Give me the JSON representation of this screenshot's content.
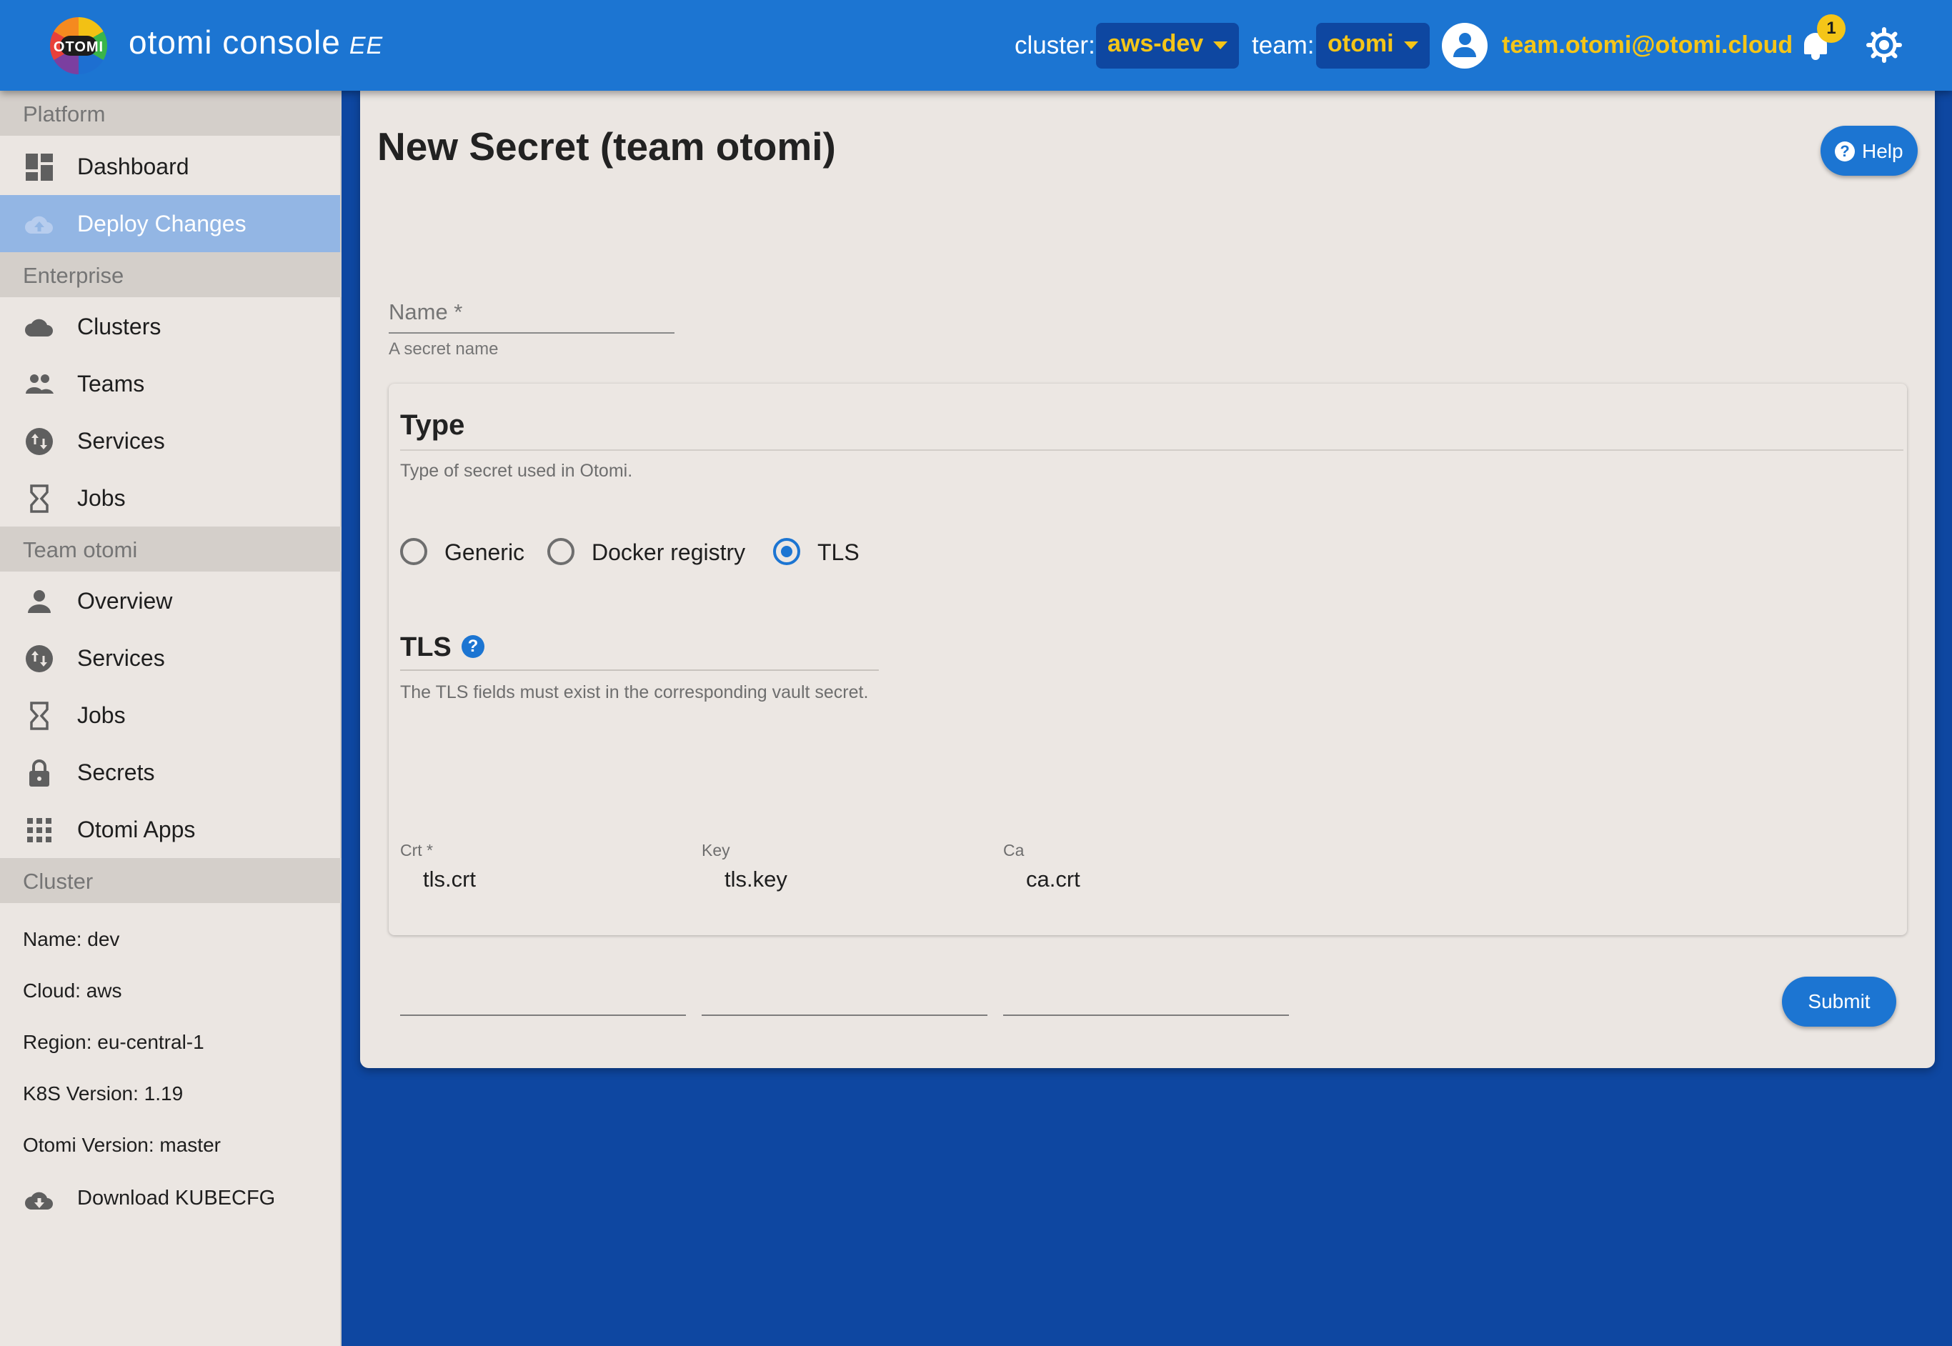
{
  "app": {
    "title": "otomi console",
    "edition": "EE",
    "logo_text": "OTOMI"
  },
  "topbar": {
    "cluster_label": "cluster:",
    "cluster_value": "aws-dev",
    "team_label": "team:",
    "team_value": "otomi",
    "user_email": "team.otomi@otomi.cloud",
    "notification_count": "1"
  },
  "sidebar": {
    "platform": {
      "title": "Platform",
      "items": [
        {
          "label": "Dashboard"
        },
        {
          "label": "Deploy Changes"
        }
      ]
    },
    "enterprise": {
      "title": "Enterprise",
      "items": [
        {
          "label": "Clusters"
        },
        {
          "label": "Teams"
        },
        {
          "label": "Services"
        },
        {
          "label": "Jobs"
        }
      ]
    },
    "team": {
      "title": "Team otomi",
      "items": [
        {
          "label": "Overview"
        },
        {
          "label": "Services"
        },
        {
          "label": "Jobs"
        },
        {
          "label": "Secrets"
        },
        {
          "label": "Otomi Apps"
        }
      ]
    },
    "cluster": {
      "title": "Cluster",
      "info": [
        "Name: dev",
        "Cloud: aws",
        "Region: eu-central-1",
        "K8S Version: 1.19",
        "Otomi Version: master"
      ],
      "download_label": "Download KUBECFG"
    }
  },
  "main": {
    "title": "New Secret (team otomi)",
    "help_label": "Help",
    "name_field": {
      "label": "Name *",
      "helper": "A secret name",
      "value": ""
    },
    "type_section": {
      "title": "Type",
      "description": "Type of secret used in Otomi.",
      "options": [
        "Generic",
        "Docker registry",
        "TLS"
      ],
      "selected": "TLS"
    },
    "tls_section": {
      "title": "TLS",
      "description": "The TLS fields must exist in the corresponding vault secret.",
      "fields": [
        {
          "label": "Crt *",
          "value": "tls.crt"
        },
        {
          "label": "Key",
          "value": "tls.key"
        },
        {
          "label": "Ca",
          "value": "ca.crt"
        }
      ]
    },
    "submit_label": "Submit"
  },
  "colors": {
    "topbar": "#1c75d2",
    "background": "#0e47a1",
    "accent_yellow": "#f5c518",
    "sidebar": "#ebe6e2",
    "active_item": "#93b6e4"
  },
  "icons": {
    "dashboard": "dashboard-icon",
    "deploy": "cloud-upload-icon",
    "clusters": "cloud-icon",
    "teams": "people-icon",
    "services": "swap-vert-icon",
    "jobs": "hourglass-icon",
    "overview": "person-icon",
    "secrets": "lock-icon",
    "apps": "apps-grid-icon",
    "download": "cloud-download-icon"
  }
}
